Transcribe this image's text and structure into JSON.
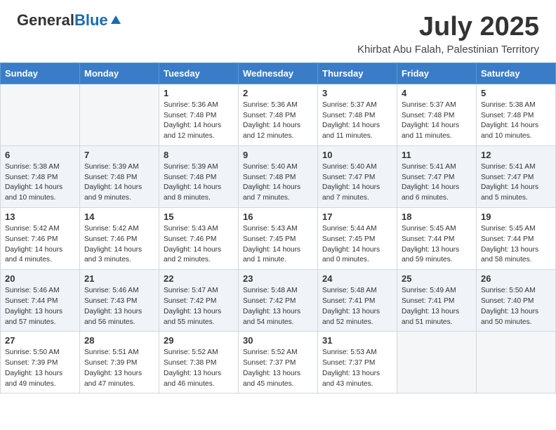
{
  "header": {
    "logo_general": "General",
    "logo_blue": "Blue",
    "month": "July 2025",
    "location": "Khirbat Abu Falah, Palestinian Territory"
  },
  "days_of_week": [
    "Sunday",
    "Monday",
    "Tuesday",
    "Wednesday",
    "Thursday",
    "Friday",
    "Saturday"
  ],
  "weeks": [
    [
      {
        "day": "",
        "sunrise": "",
        "sunset": "",
        "daylight": ""
      },
      {
        "day": "",
        "sunrise": "",
        "sunset": "",
        "daylight": ""
      },
      {
        "day": "1",
        "sunrise": "Sunrise: 5:36 AM",
        "sunset": "Sunset: 7:48 PM",
        "daylight": "Daylight: 14 hours and 12 minutes."
      },
      {
        "day": "2",
        "sunrise": "Sunrise: 5:36 AM",
        "sunset": "Sunset: 7:48 PM",
        "daylight": "Daylight: 14 hours and 12 minutes."
      },
      {
        "day": "3",
        "sunrise": "Sunrise: 5:37 AM",
        "sunset": "Sunset: 7:48 PM",
        "daylight": "Daylight: 14 hours and 11 minutes."
      },
      {
        "day": "4",
        "sunrise": "Sunrise: 5:37 AM",
        "sunset": "Sunset: 7:48 PM",
        "daylight": "Daylight: 14 hours and 11 minutes."
      },
      {
        "day": "5",
        "sunrise": "Sunrise: 5:38 AM",
        "sunset": "Sunset: 7:48 PM",
        "daylight": "Daylight: 14 hours and 10 minutes."
      }
    ],
    [
      {
        "day": "6",
        "sunrise": "Sunrise: 5:38 AM",
        "sunset": "Sunset: 7:48 PM",
        "daylight": "Daylight: 14 hours and 10 minutes."
      },
      {
        "day": "7",
        "sunrise": "Sunrise: 5:39 AM",
        "sunset": "Sunset: 7:48 PM",
        "daylight": "Daylight: 14 hours and 9 minutes."
      },
      {
        "day": "8",
        "sunrise": "Sunrise: 5:39 AM",
        "sunset": "Sunset: 7:48 PM",
        "daylight": "Daylight: 14 hours and 8 minutes."
      },
      {
        "day": "9",
        "sunrise": "Sunrise: 5:40 AM",
        "sunset": "Sunset: 7:48 PM",
        "daylight": "Daylight: 14 hours and 7 minutes."
      },
      {
        "day": "10",
        "sunrise": "Sunrise: 5:40 AM",
        "sunset": "Sunset: 7:47 PM",
        "daylight": "Daylight: 14 hours and 7 minutes."
      },
      {
        "day": "11",
        "sunrise": "Sunrise: 5:41 AM",
        "sunset": "Sunset: 7:47 PM",
        "daylight": "Daylight: 14 hours and 6 minutes."
      },
      {
        "day": "12",
        "sunrise": "Sunrise: 5:41 AM",
        "sunset": "Sunset: 7:47 PM",
        "daylight": "Daylight: 14 hours and 5 minutes."
      }
    ],
    [
      {
        "day": "13",
        "sunrise": "Sunrise: 5:42 AM",
        "sunset": "Sunset: 7:46 PM",
        "daylight": "Daylight: 14 hours and 4 minutes."
      },
      {
        "day": "14",
        "sunrise": "Sunrise: 5:42 AM",
        "sunset": "Sunset: 7:46 PM",
        "daylight": "Daylight: 14 hours and 3 minutes."
      },
      {
        "day": "15",
        "sunrise": "Sunrise: 5:43 AM",
        "sunset": "Sunset: 7:46 PM",
        "daylight": "Daylight: 14 hours and 2 minutes."
      },
      {
        "day": "16",
        "sunrise": "Sunrise: 5:43 AM",
        "sunset": "Sunset: 7:45 PM",
        "daylight": "Daylight: 14 hours and 1 minute."
      },
      {
        "day": "17",
        "sunrise": "Sunrise: 5:44 AM",
        "sunset": "Sunset: 7:45 PM",
        "daylight": "Daylight: 14 hours and 0 minutes."
      },
      {
        "day": "18",
        "sunrise": "Sunrise: 5:45 AM",
        "sunset": "Sunset: 7:44 PM",
        "daylight": "Daylight: 13 hours and 59 minutes."
      },
      {
        "day": "19",
        "sunrise": "Sunrise: 5:45 AM",
        "sunset": "Sunset: 7:44 PM",
        "daylight": "Daylight: 13 hours and 58 minutes."
      }
    ],
    [
      {
        "day": "20",
        "sunrise": "Sunrise: 5:46 AM",
        "sunset": "Sunset: 7:44 PM",
        "daylight": "Daylight: 13 hours and 57 minutes."
      },
      {
        "day": "21",
        "sunrise": "Sunrise: 5:46 AM",
        "sunset": "Sunset: 7:43 PM",
        "daylight": "Daylight: 13 hours and 56 minutes."
      },
      {
        "day": "22",
        "sunrise": "Sunrise: 5:47 AM",
        "sunset": "Sunset: 7:42 PM",
        "daylight": "Daylight: 13 hours and 55 minutes."
      },
      {
        "day": "23",
        "sunrise": "Sunrise: 5:48 AM",
        "sunset": "Sunset: 7:42 PM",
        "daylight": "Daylight: 13 hours and 54 minutes."
      },
      {
        "day": "24",
        "sunrise": "Sunrise: 5:48 AM",
        "sunset": "Sunset: 7:41 PM",
        "daylight": "Daylight: 13 hours and 52 minutes."
      },
      {
        "day": "25",
        "sunrise": "Sunrise: 5:49 AM",
        "sunset": "Sunset: 7:41 PM",
        "daylight": "Daylight: 13 hours and 51 minutes."
      },
      {
        "day": "26",
        "sunrise": "Sunrise: 5:50 AM",
        "sunset": "Sunset: 7:40 PM",
        "daylight": "Daylight: 13 hours and 50 minutes."
      }
    ],
    [
      {
        "day": "27",
        "sunrise": "Sunrise: 5:50 AM",
        "sunset": "Sunset: 7:39 PM",
        "daylight": "Daylight: 13 hours and 49 minutes."
      },
      {
        "day": "28",
        "sunrise": "Sunrise: 5:51 AM",
        "sunset": "Sunset: 7:39 PM",
        "daylight": "Daylight: 13 hours and 47 minutes."
      },
      {
        "day": "29",
        "sunrise": "Sunrise: 5:52 AM",
        "sunset": "Sunset: 7:38 PM",
        "daylight": "Daylight: 13 hours and 46 minutes."
      },
      {
        "day": "30",
        "sunrise": "Sunrise: 5:52 AM",
        "sunset": "Sunset: 7:37 PM",
        "daylight": "Daylight: 13 hours and 45 minutes."
      },
      {
        "day": "31",
        "sunrise": "Sunrise: 5:53 AM",
        "sunset": "Sunset: 7:37 PM",
        "daylight": "Daylight: 13 hours and 43 minutes."
      },
      {
        "day": "",
        "sunrise": "",
        "sunset": "",
        "daylight": ""
      },
      {
        "day": "",
        "sunrise": "",
        "sunset": "",
        "daylight": ""
      }
    ]
  ]
}
